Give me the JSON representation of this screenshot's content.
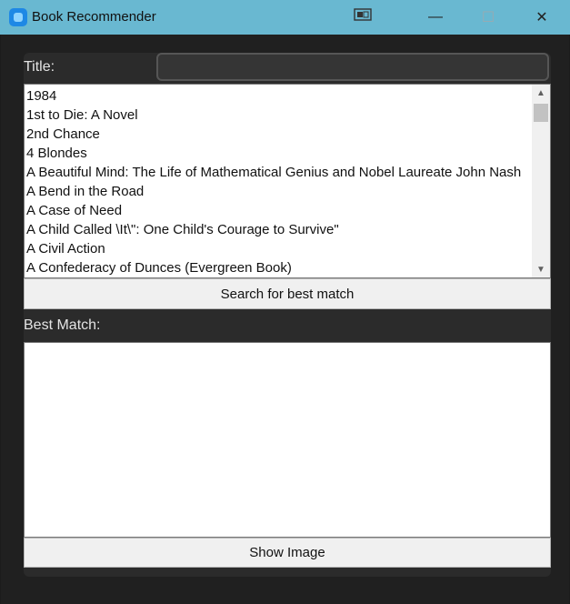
{
  "window": {
    "title": "Book Recommender",
    "minimize_glyph": "—",
    "maximize_glyph": "☐",
    "close_glyph": "✕"
  },
  "title_field": {
    "label": "Title:",
    "value": "",
    "placeholder": ""
  },
  "book_list": {
    "items": [
      "1984",
      "1st to Die: A Novel",
      "2nd Chance",
      "4 Blondes",
      "A Beautiful Mind: The Life of Mathematical Genius and Nobel Laureate John Nash",
      "A Bend in the Road",
      "A Case of Need",
      "A Child Called \\It\\\": One Child's Courage to Survive\"",
      "A Civil Action",
      "A Confederacy of Dunces (Evergreen Book)"
    ],
    "scroll_position": 0.02
  },
  "search_button": {
    "label": "Search for best match"
  },
  "best_match": {
    "label": "Best Match:",
    "value": ""
  },
  "show_image_button": {
    "label": "Show Image"
  },
  "colors": {
    "titlebar": "#69b8d1",
    "background": "#202020",
    "panel": "#2b2b2b"
  },
  "icons": [
    "app-icon",
    "snap-layout-icon",
    "minimize-icon",
    "maximize-icon",
    "close-icon",
    "scroll-up-arrow-icon",
    "scroll-down-arrow-icon"
  ]
}
